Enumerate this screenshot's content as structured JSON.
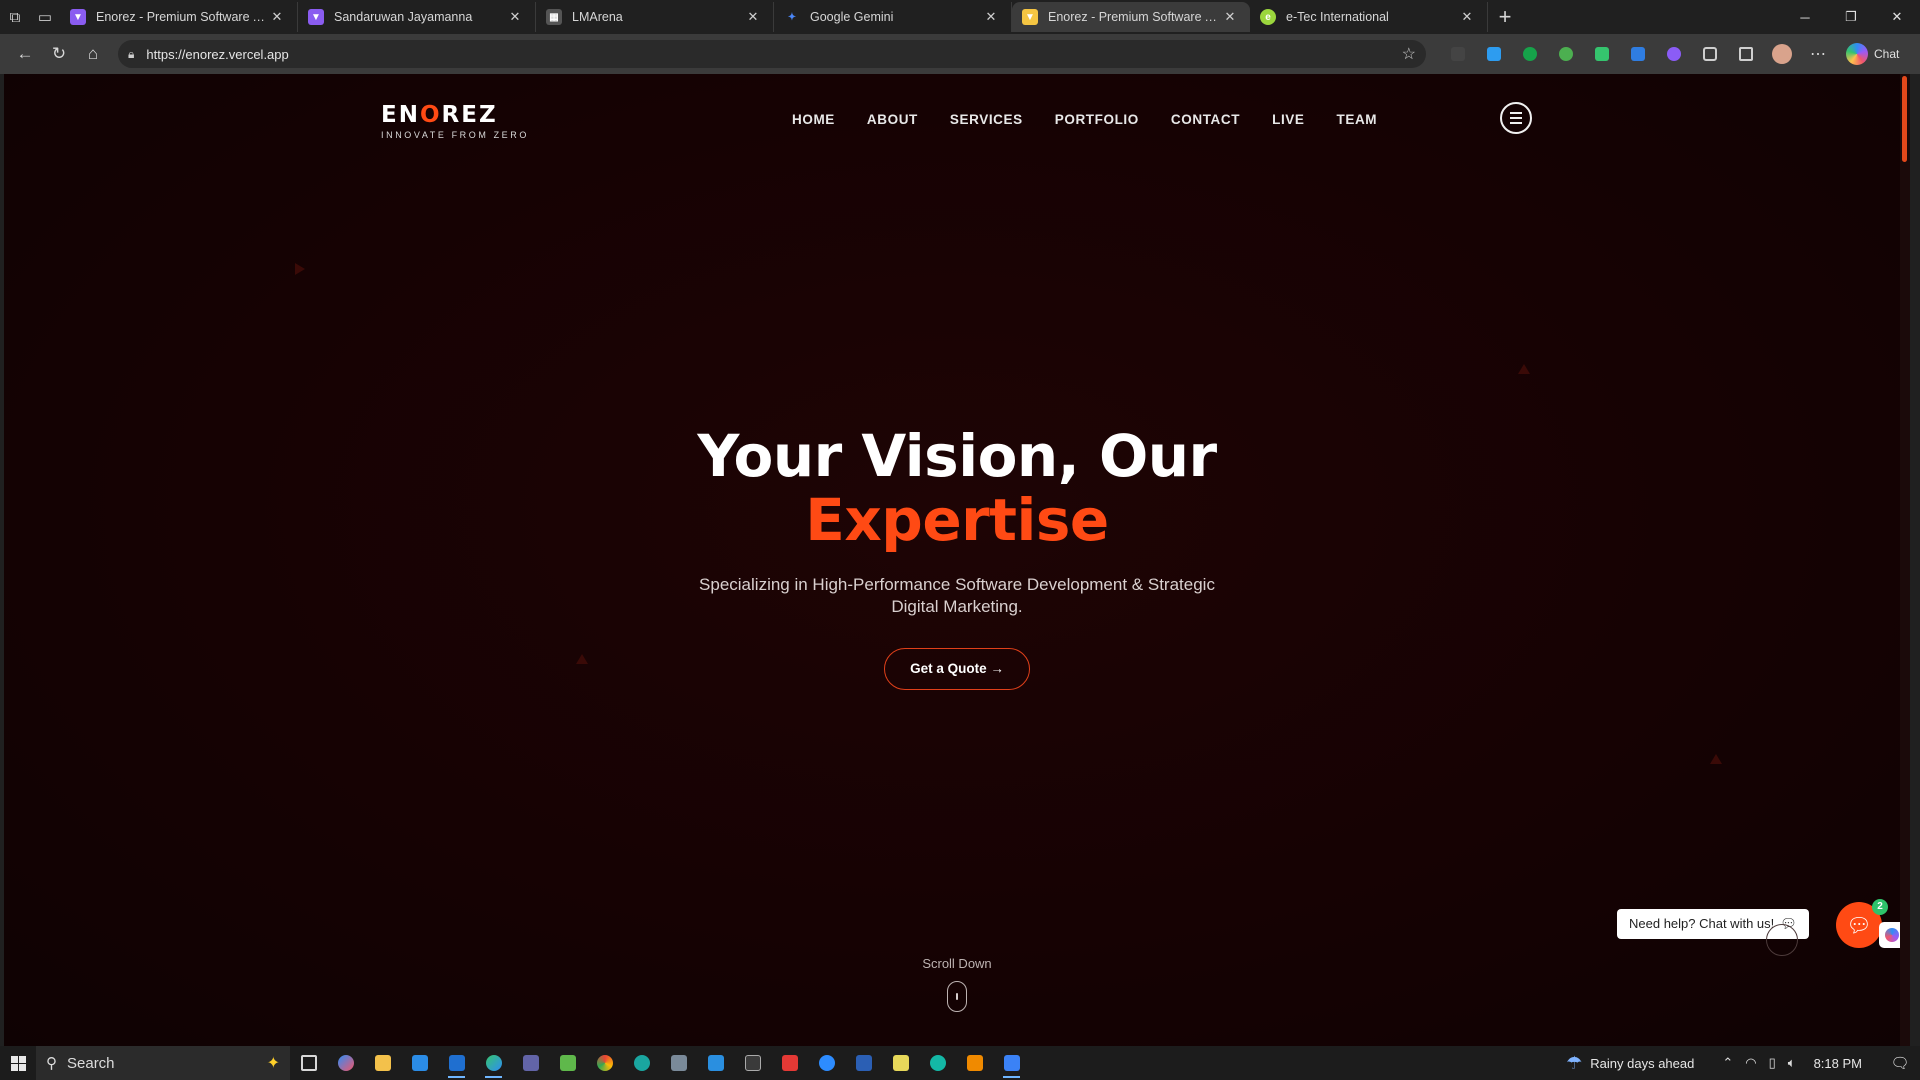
{
  "browser": {
    "tabs": [
      {
        "title": "Enorez - Premium Software Agency",
        "favicon_color": "#8a5cf0",
        "active": false
      },
      {
        "title": "Sandaruwan Jayamanna",
        "favicon_color": "#8a5cf0",
        "active": false
      },
      {
        "title": "LMArena",
        "favicon_color": "#555555",
        "active": false
      },
      {
        "title": "Google Gemini",
        "favicon_color": "#4a86f7",
        "active": false
      },
      {
        "title": "Enorez - Premium Software Agency",
        "favicon_color": "#f5c542",
        "active": true
      },
      {
        "title": "e-Tec International",
        "favicon_color": "#9bd63d",
        "active": false
      }
    ],
    "new_tab_label": "+",
    "url": "https://enorez.vercel.app",
    "chat_label": "Chat"
  },
  "site": {
    "logo": {
      "part1": "EN",
      "part2": "O",
      "part3": "REZ",
      "tagline": "INNOVATE FROM ZERO"
    },
    "nav": [
      "HOME",
      "ABOUT",
      "SERVICES",
      "PORTFOLIO",
      "CONTACT",
      "LIVE",
      "TEAM"
    ],
    "hero": {
      "title_line1": "Your Vision, Our",
      "title_line2": "Expertise",
      "subtitle": "Specializing in High-Performance Software Development & Strategic Digital Marketing.",
      "cta": "Get a Quote →"
    },
    "scroll_label": "Scroll Down",
    "chat": {
      "help_text": "Need help? Chat with us!",
      "badge_count": "2"
    },
    "colors": {
      "accent": "#ff4a14",
      "background": "#160203"
    }
  },
  "taskbar": {
    "search_placeholder": "Search",
    "weather": "Rainy days ahead",
    "time": "8:18 PM"
  }
}
